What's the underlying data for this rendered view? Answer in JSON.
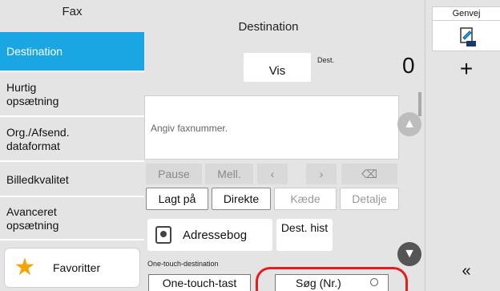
{
  "sidebar": {
    "title": "Fax",
    "items": [
      {
        "label": "Destination",
        "active": true
      },
      {
        "label": "Hurtig opsætning"
      },
      {
        "label": "Org./Afsend. dataformat"
      },
      {
        "label": "Billedkvalitet"
      },
      {
        "label": "Avanceret opsætning"
      }
    ],
    "favorites_label": "Favoritter"
  },
  "main": {
    "title": "Destination",
    "vis_label": "Vis",
    "dest_small": "Dest.",
    "dest_count": "0",
    "input_placeholder": "Angiv faxnummer.",
    "keys": {
      "pause": "Pause",
      "mell": "Mell.",
      "left": "‹",
      "right": "›",
      "backspace": "⌫"
    },
    "buttons": {
      "lagt_paa": "Lagt på",
      "direkte": "Direkte",
      "kaede": "Kæde",
      "detalje": "Detalje"
    },
    "adressebog": "Adressebog",
    "dest_hist": "Dest. hist",
    "onetouch_label": "One-touch-destination",
    "onetouch_btn": "One-touch-tast",
    "search_btn": "Søg (Nr.)"
  },
  "right_panel": {
    "genvej": "Genvej",
    "plus": "+",
    "collapse": "«"
  },
  "colors": {
    "accent": "#1aa6e2",
    "highlight": "#e41e1e",
    "favorite_star": "#f5a300"
  }
}
